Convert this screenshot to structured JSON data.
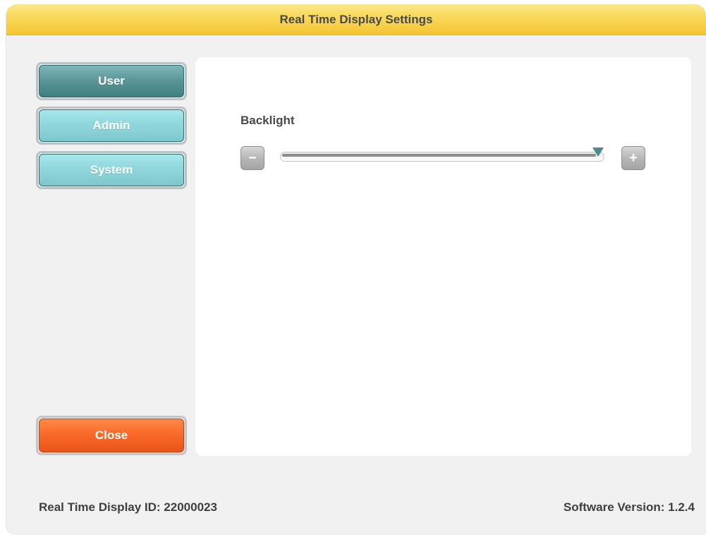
{
  "window": {
    "title": "Real Time Display Settings"
  },
  "nav": {
    "items": [
      {
        "label": "User",
        "active": true
      },
      {
        "label": "Admin",
        "active": false
      },
      {
        "label": "System",
        "active": false
      }
    ],
    "close_label": "Close"
  },
  "settings": {
    "backlight": {
      "label": "Backlight",
      "level_fraction": 0.98,
      "decrease_icon": "minus-icon",
      "increase_icon": "plus-icon"
    }
  },
  "footer": {
    "display_id": "Real Time Display ID: 22000023",
    "software_version": "Software Version: 1.2.4"
  },
  "colors": {
    "title_bar": "#f6c533",
    "nav_active": "#4f8a8c",
    "nav_idle": "#8fd7dc",
    "close": "#f86a2a",
    "slider_thumb": "#4f8a8c"
  }
}
